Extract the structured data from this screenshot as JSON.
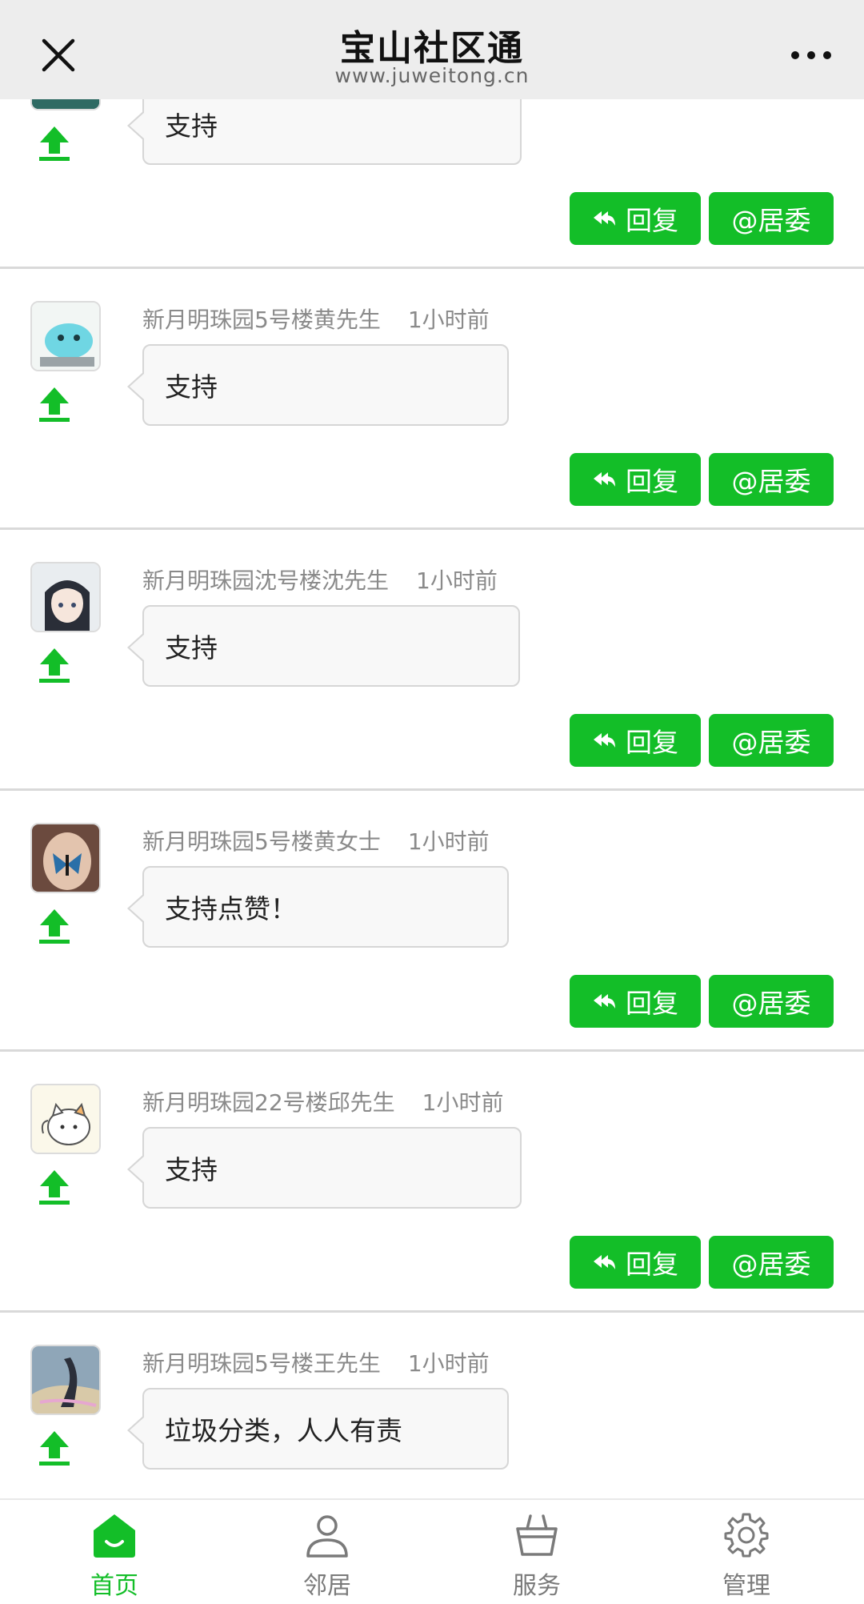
{
  "header": {
    "title": "宝山社区通",
    "subtitle": "www.juweitong.cn"
  },
  "actions": {
    "reply_label": "回复",
    "at_label": "@居委"
  },
  "posts": [
    {
      "author": "",
      "time": "",
      "text": "支持",
      "avatar": "teal-scene-avatar"
    },
    {
      "author": "新月明珠园5号楼黄先生",
      "time": "1小时前",
      "text": "支持",
      "avatar": "blue-cartoon-avatar"
    },
    {
      "author": "新月明珠园沈号楼沈先生",
      "time": "1小时前",
      "text": "支持",
      "avatar": "anime-girl-avatar"
    },
    {
      "author": "新月明珠园5号楼黄女士",
      "time": "1小时前",
      "text": "支持点赞！",
      "avatar": "butterfly-face-avatar"
    },
    {
      "author": "新月明珠园22号楼邱先生",
      "time": "1小时前",
      "text": "支持",
      "avatar": "cat-cartoon-avatar"
    },
    {
      "author": "新月明珠园5号楼王先生",
      "time": "1小时前",
      "text": "垃圾分类，人人有责",
      "avatar": "painted-figure-avatar"
    }
  ],
  "tabbar": {
    "tabs": [
      {
        "label": "首页",
        "icon": "home-icon",
        "active": true
      },
      {
        "label": "邻居",
        "icon": "person-icon",
        "active": false
      },
      {
        "label": "服务",
        "icon": "basket-icon",
        "active": false
      },
      {
        "label": "管理",
        "icon": "gear-icon",
        "active": false
      }
    ]
  },
  "colors": {
    "accent": "#13be28",
    "header_bg": "#ededed",
    "meta_text": "#8a8a8a"
  }
}
